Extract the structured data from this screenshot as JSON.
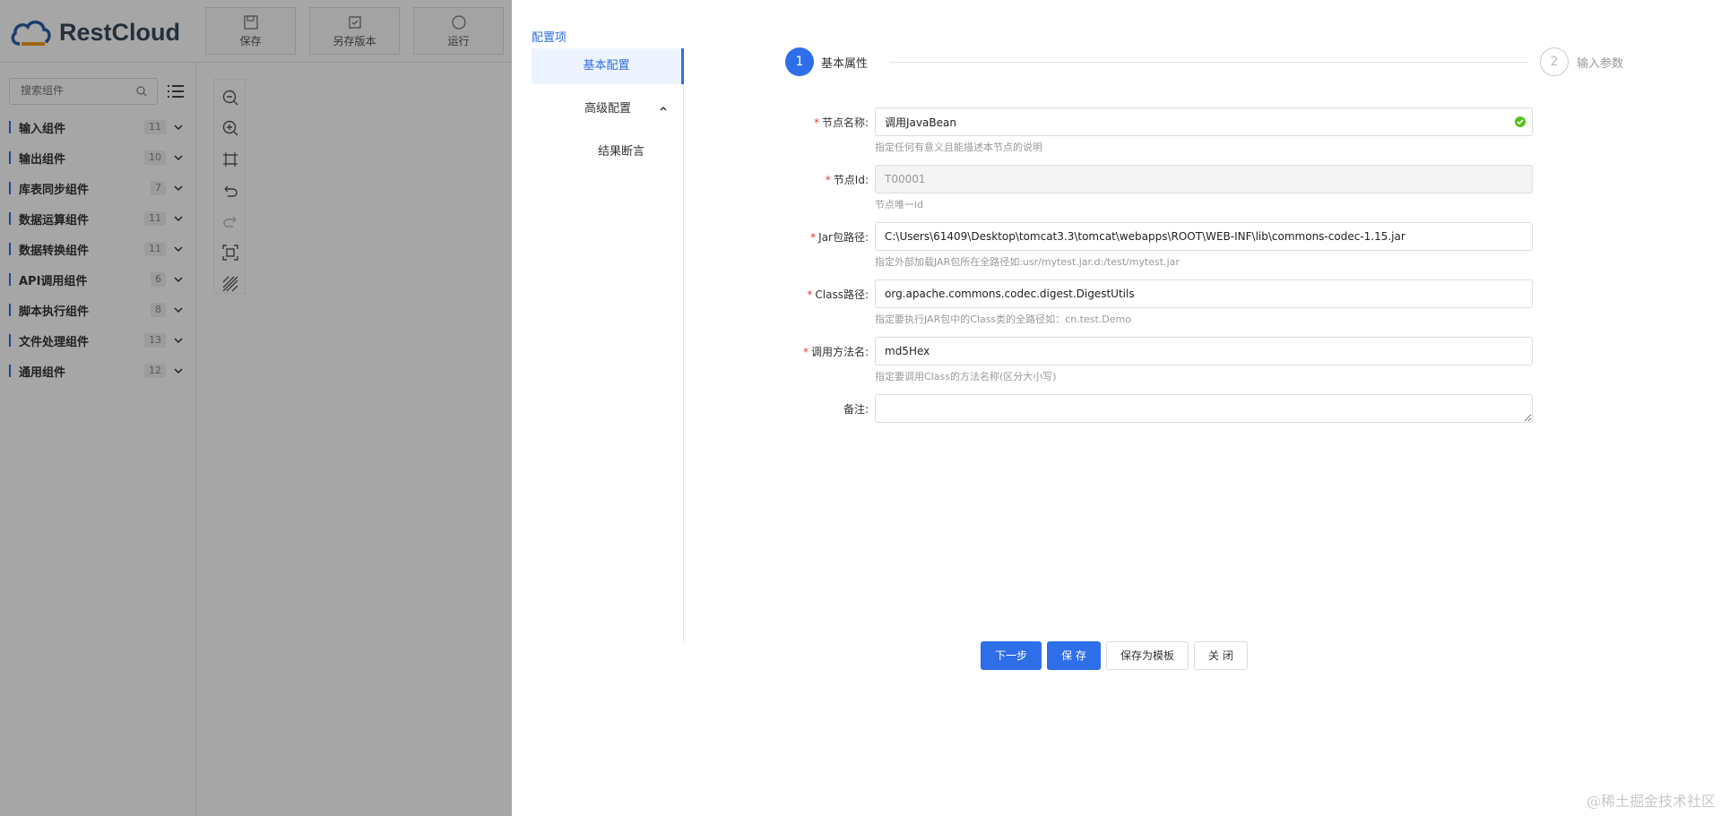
{
  "app": {
    "logo_text": "RestCloud",
    "toolbar": [
      {
        "label": "保存",
        "icon": "save-icon"
      },
      {
        "label": "另存版本",
        "icon": "save-version-icon"
      },
      {
        "label": "运行",
        "icon": "run-icon"
      }
    ],
    "search_placeholder": "搜索组件",
    "categories": [
      {
        "name": "输入组件",
        "count": "11"
      },
      {
        "name": "输出组件",
        "count": "10"
      },
      {
        "name": "库表同步组件",
        "count": "7"
      },
      {
        "name": "数据运算组件",
        "count": "11"
      },
      {
        "name": "数据转换组件",
        "count": "11"
      },
      {
        "name": "API调用组件",
        "count": "6"
      },
      {
        "name": "脚本执行组件",
        "count": "8"
      },
      {
        "name": "文件处理组件",
        "count": "13"
      },
      {
        "name": "通用组件",
        "count": "12"
      }
    ],
    "canvas_tools": [
      "zoom-out-icon",
      "zoom-in-icon",
      "fit-icon",
      "undo-icon",
      "redo-icon",
      "fullscreen-icon",
      "grid-icon"
    ]
  },
  "drawer": {
    "section_title": "配置项",
    "nav": {
      "basic": "基本配置",
      "advanced": "高级配置",
      "assert": "结果断言"
    },
    "steps": [
      {
        "num": "1",
        "label": "基本属性"
      },
      {
        "num": "2",
        "label": "输入参数"
      }
    ],
    "form": {
      "node_name": {
        "label": "节点名称:",
        "value": "调用JavaBean",
        "hint": "指定任何有意义且能描述本节点的说明"
      },
      "node_id": {
        "label": "节点Id:",
        "value": "T00001",
        "hint": "节点唯一id"
      },
      "jar_path": {
        "label": "Jar包路径:",
        "value": "C:\\Users\\61409\\Desktop\\tomcat3.3\\tomcat\\webapps\\ROOT\\WEB-INF\\lib\\commons-codec-1.15.jar",
        "hint": "指定外部加载JAR包所在全路径如:usr/mytest.jar.d:/test/mytest.jar"
      },
      "class_path": {
        "label": "Class路径:",
        "value": "org.apache.commons.codec.digest.DigestUtils",
        "hint": "指定要执行JAR包中的Class类的全路径如：cn.test.Demo"
      },
      "method_name": {
        "label": "调用方法名:",
        "value": "md5Hex",
        "hint": "指定要调用Class的方法名称(区分大小写)"
      },
      "remark": {
        "label": "备注:",
        "value": ""
      }
    },
    "buttons": {
      "next": "下一步",
      "save": "保 存",
      "save_template": "保存为模板",
      "close": "关 闭"
    }
  },
  "watermark": "@稀土掘金技术社区",
  "colors": {
    "accent": "#2e6ee8",
    "required": "#e33333",
    "success": "#52c41a"
  }
}
